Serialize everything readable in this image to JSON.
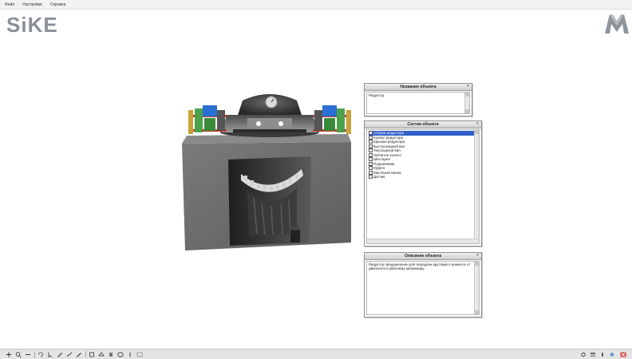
{
  "app": {
    "logo_text": "SiKE",
    "menu": [
      "Файл",
      "Настройки",
      "Справка"
    ]
  },
  "panels": {
    "top": {
      "title": "Название объекта",
      "text": "Редуктор"
    },
    "tree": {
      "title": "Состав объекта",
      "items": [
        "Сборка редуктора",
        "Корпус редуктора",
        "Крышка редуктора",
        "Быстроходный вал",
        "Тихоходный вал",
        "Зубчатое колесо",
        "Шестерня",
        "Подшипники",
        "Муфта",
        "Масляная ванна",
        "Датчик"
      ]
    },
    "description": {
      "title": "Описание объекта",
      "text": "Редуктор предназначен для передачи крутящего момента от двигателя к рабочему механизму."
    }
  },
  "toolbar": {
    "left_icons": [
      "pan-icon",
      "zoom-in-icon",
      "zoom-out-icon",
      "rotate-icon",
      "edit-icon",
      "measure-icon",
      "view-front-icon",
      "view-top-icon",
      "view-side-icon",
      "view-iso-icon",
      "split-icon",
      "fit-icon"
    ],
    "right_icons": [
      "settings-icon",
      "layers-icon",
      "info-icon",
      "help-icon",
      "close-icon"
    ]
  },
  "colors": {
    "accent_selection": "#2f5ec9",
    "model_frame": "#6c6c6c",
    "motor_blue": "#2a6fd6",
    "gear_green": "#4ba14b",
    "bar_red": "#c23a2a"
  }
}
